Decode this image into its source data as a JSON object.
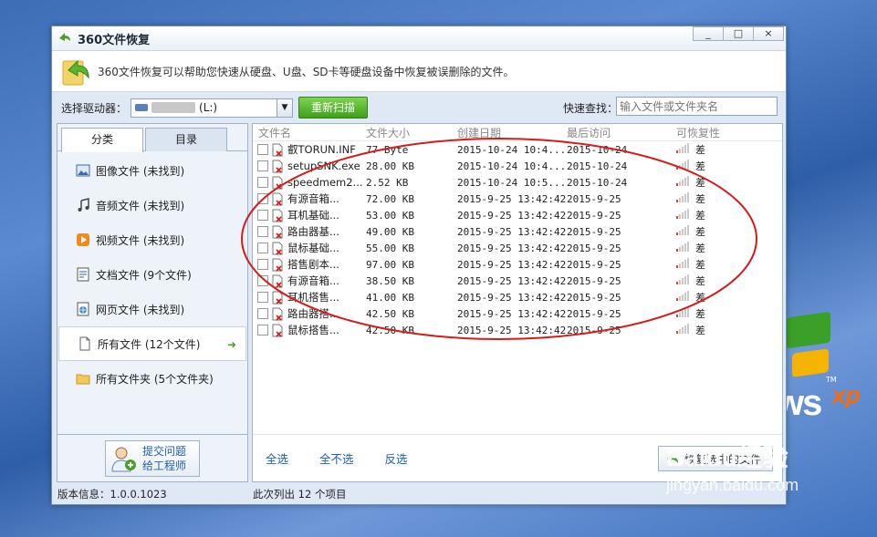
{
  "app": {
    "title": "360文件恢复",
    "banner_text": "360文件恢复可以帮助您快速从硬盘、U盘、SD卡等硬盘设备中恢复被误删除的文件。",
    "window_controls": [
      "_",
      "□",
      "×"
    ]
  },
  "toolbar": {
    "drive_label": "选择驱动器：",
    "drive_value": "(L:)",
    "scan_label": "重新扫描",
    "search_label": "快速查找：",
    "search_placeholder": "输入文件或文件夹名"
  },
  "sidebar": {
    "tabs": [
      {
        "label": "分类",
        "active": true
      },
      {
        "label": "目录",
        "active": false
      }
    ],
    "items": [
      {
        "label": "图像文件 (未找到)",
        "icon": "image-icon",
        "active": false
      },
      {
        "label": "音频文件 (未找到)",
        "icon": "music-note-icon",
        "active": false
      },
      {
        "label": "视频文件 (未找到)",
        "icon": "video-icon",
        "active": false
      },
      {
        "label": "文档文件 (9个文件)",
        "icon": "document-icon",
        "active": false
      },
      {
        "label": "网页文件 (未找到)",
        "icon": "webpage-icon",
        "active": false
      },
      {
        "label": "所有文件 (12个文件)",
        "icon": "file-icon",
        "active": true
      },
      {
        "label": "所有文件夹 (5个文件夹)",
        "icon": "folder-icon",
        "active": false
      }
    ],
    "feedback": {
      "line1": "提交问题",
      "line2": "给工程师"
    }
  },
  "table": {
    "headers": [
      "文件名",
      "文件大小",
      "创建日期",
      "最后访问",
      "可恢复性"
    ],
    "rows": [
      {
        "name": "叡TORUN.INF",
        "size": "77 Byte",
        "created": "2015-10-24 10:4...",
        "accessed": "2015-10-24",
        "recover": "差"
      },
      {
        "name": "setupSNK.exe",
        "size": "28.00 KB",
        "created": "2015-10-24 10:4...",
        "accessed": "2015-10-24",
        "recover": "差"
      },
      {
        "name": "speedmem2...",
        "size": "2.52 KB",
        "created": "2015-10-24 10:5...",
        "accessed": "2015-10-24",
        "recover": "差"
      },
      {
        "name": "有源音箱...",
        "size": "72.00 KB",
        "created": "2015-9-25 13:42:42",
        "accessed": "2015-9-25",
        "recover": "差"
      },
      {
        "name": "耳机基础...",
        "size": "53.00 KB",
        "created": "2015-9-25 13:42:42",
        "accessed": "2015-9-25",
        "recover": "差"
      },
      {
        "name": "路由器基...",
        "size": "49.00 KB",
        "created": "2015-9-25 13:42:42",
        "accessed": "2015-9-25",
        "recover": "差"
      },
      {
        "name": "鼠标基础...",
        "size": "55.00 KB",
        "created": "2015-9-25 13:42:42",
        "accessed": "2015-9-25",
        "recover": "差"
      },
      {
        "name": "搭售剧本...",
        "size": "97.00 KB",
        "created": "2015-9-25 13:42:42",
        "accessed": "2015-9-25",
        "recover": "差"
      },
      {
        "name": "有源音箱...",
        "size": "38.50 KB",
        "created": "2015-9-25 13:42:42",
        "accessed": "2015-9-25",
        "recover": "差"
      },
      {
        "name": "耳机搭售...",
        "size": "41.00 KB",
        "created": "2015-9-25 13:42:42",
        "accessed": "2015-9-25",
        "recover": "差"
      },
      {
        "name": "路由器搭...",
        "size": "42.50 KB",
        "created": "2015-9-25 13:42:42",
        "accessed": "2015-9-25",
        "recover": "差"
      },
      {
        "name": "鼠标搭售...",
        "size": "42.50 KB",
        "created": "2015-9-25 13:42:42",
        "accessed": "2015-9-25",
        "recover": "差"
      }
    ],
    "select_all": "全选",
    "select_none": "全不选",
    "invert": "反选",
    "recover_button": "恢复选中的文件"
  },
  "status": {
    "version": "版本信息：1.0.0.1023",
    "listed": "此次列出 12 个项目"
  },
  "watermark": {
    "main": "Baidu经验",
    "sub": "jingyan.baidu.com"
  },
  "desktop": {
    "logo_text": "ws",
    "logo_super": "xp",
    "logo_tm": "TM"
  },
  "colors": {
    "accent_green": "#3e9f1c",
    "link_blue": "#1f5fb5",
    "annotation_red": "#d41c1c"
  }
}
